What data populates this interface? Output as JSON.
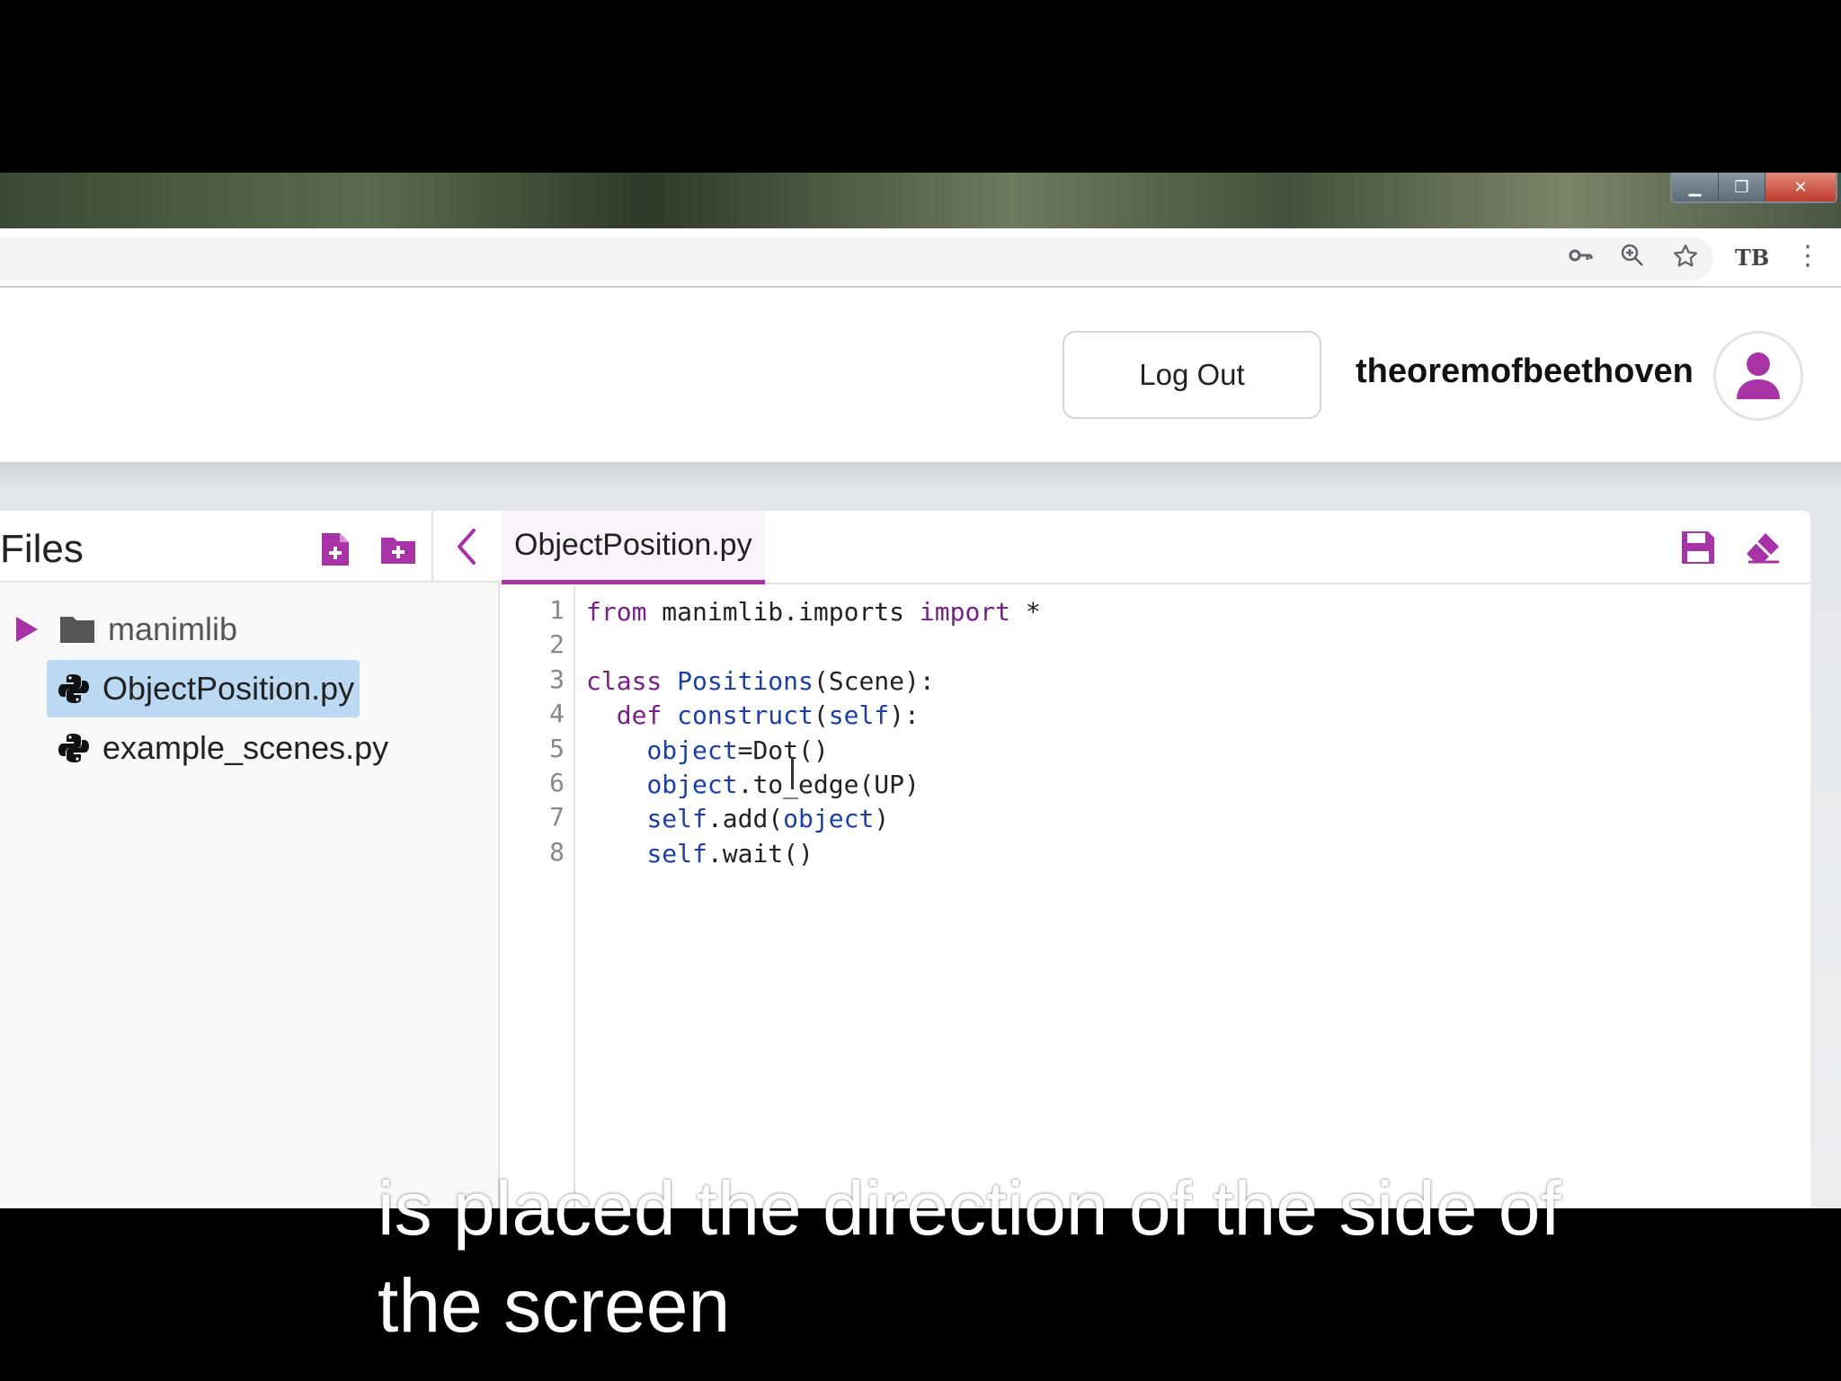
{
  "window": {
    "controls": {
      "minimize": "▁",
      "restore": "❐",
      "close": "✕"
    }
  },
  "browser": {
    "icons": [
      "key-icon",
      "zoom-icon",
      "star-icon",
      "extension-icon",
      "menu-icon"
    ],
    "extension_label": "TB",
    "menu_glyph": "⋮"
  },
  "header": {
    "logout_label": "Log Out",
    "username": "theoremofbeethoven"
  },
  "files": {
    "title": "Files",
    "items": [
      {
        "type": "folder",
        "name": "manimlib"
      },
      {
        "type": "file",
        "name": "ObjectPosition.py",
        "selected": true
      },
      {
        "type": "file",
        "name": "example_scenes.py"
      }
    ]
  },
  "editor": {
    "tab_label": "ObjectPosition.py",
    "line_numbers": [
      "1",
      "2",
      "3",
      "4",
      "5",
      "6",
      "7",
      "8"
    ],
    "code": [
      "from manimlib.imports import *",
      "",
      "class Positions(Scene):",
      "  def construct(self):",
      "    object=Dot()",
      "    object.to_edge(UP)",
      "    self.add(object)",
      "    self.wait()"
    ]
  },
  "subtitle": {
    "line1": "is placed the direction of the side of",
    "line2": "the screen"
  },
  "colors": {
    "accent": "#a733a7",
    "selection": "#bcd9f3",
    "keyword": "#7a1f8a"
  }
}
